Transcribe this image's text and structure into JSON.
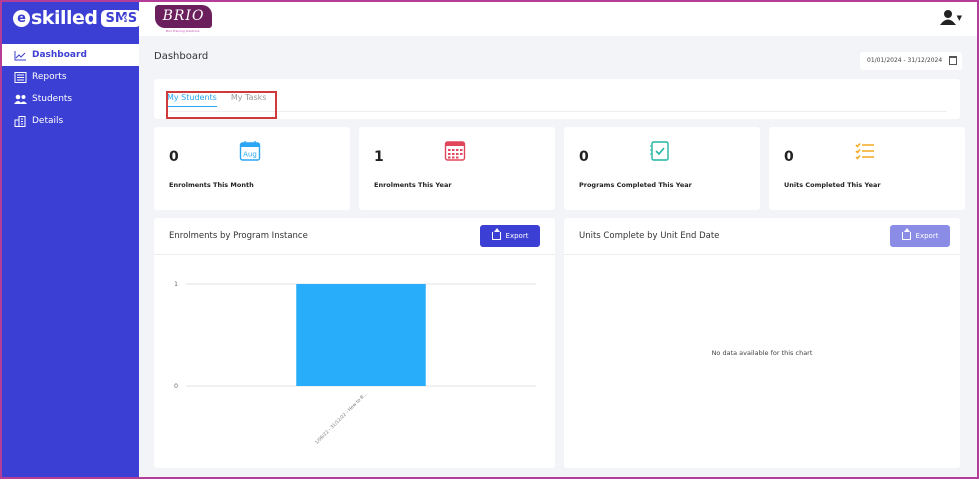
{
  "sidebar": {
    "brand": {
      "e_letter": "e",
      "name": "skilled",
      "badge": "SMS",
      "collapse": "«"
    },
    "items": [
      {
        "label": "Dashboard",
        "icon": "line-chart-icon",
        "active": true
      },
      {
        "label": "Reports",
        "icon": "report-icon",
        "active": false
      },
      {
        "label": "Students",
        "icon": "users-icon",
        "active": false
      },
      {
        "label": "Details",
        "icon": "building-icon",
        "active": false
      }
    ]
  },
  "topbar": {
    "logo_text": "BRIO",
    "logo_sub": "Brio Training Solutions"
  },
  "page": {
    "title": "Dashboard",
    "date_range": "01/01/2024 - 31/12/2024"
  },
  "tabs": [
    "My Students",
    "My Tasks"
  ],
  "stats": [
    {
      "value": "0",
      "label": "Enrolments This Month",
      "icon": "calendar-aug-icon",
      "icon_text": "Aug"
    },
    {
      "value": "1",
      "label": "Enrolments This Year",
      "icon": "calendar-grid-icon"
    },
    {
      "value": "0",
      "label": "Programs Completed This Year",
      "icon": "checklist-icon"
    },
    {
      "value": "0",
      "label": "Units Completed This Year",
      "icon": "task-list-icon"
    }
  ],
  "panels": {
    "left": {
      "title": "Enrolments by Program Instance",
      "export_label": "Export"
    },
    "right": {
      "title": "Units Complete by Unit End Date",
      "export_label": "Export",
      "empty_text": "No data available for this chart"
    }
  },
  "colors": {
    "sidebar": "#3c3fd3",
    "bar": "#27adf9",
    "export_active": "#3c3fd3",
    "export_disabled": "#8a8ce6",
    "highlight": "#d13a3a"
  },
  "chart_data": {
    "type": "bar",
    "categories": [
      "1/06/22 - 31/12/22 - How to B..."
    ],
    "values": [
      1
    ],
    "ylim": [
      0,
      1
    ],
    "yticks": [
      "0",
      "1"
    ],
    "grid": true
  }
}
